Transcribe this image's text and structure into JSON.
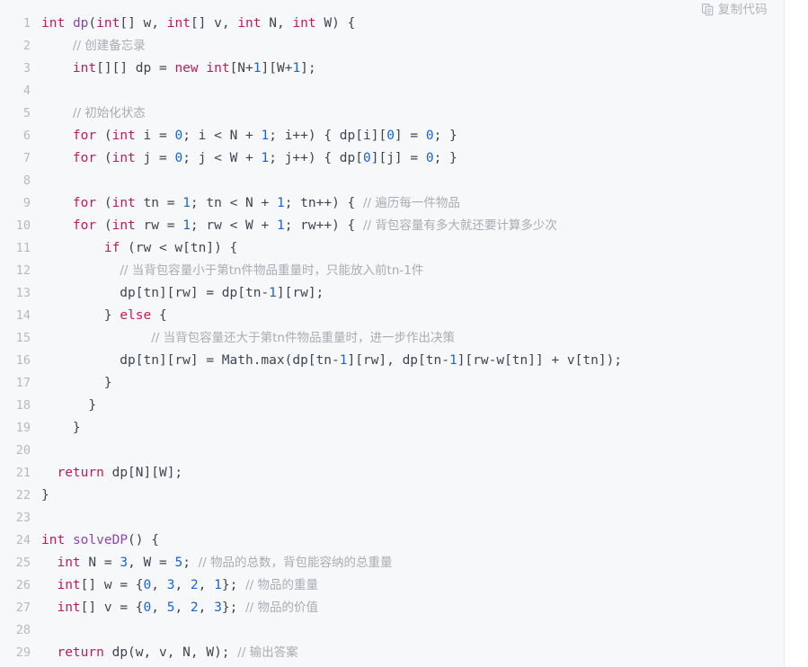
{
  "toolbar": {
    "copy_label": "复制代码",
    "copy_icon": "copy-icon"
  },
  "colors": {
    "background": "#f7f8fa",
    "page": "#ffffff",
    "border": "#e6e8eb",
    "line_number": "#b6bac0",
    "plain_text": "#3f4451",
    "keyword": "#c2185b",
    "function": "#8e44ad",
    "number": "#1565d8",
    "comment": "#a8acb3"
  },
  "editor": {
    "language": "java",
    "first_line": 1,
    "last_line": 29,
    "total_lines": 29,
    "line_numbers": [
      "1",
      "2",
      "3",
      "4",
      "5",
      "6",
      "7",
      "8",
      "9",
      "10",
      "11",
      "12",
      "13",
      "14",
      "15",
      "16",
      "17",
      "18",
      "19",
      "20",
      "21",
      "22",
      "23",
      "24",
      "25",
      "26",
      "27",
      "28",
      "29"
    ],
    "lines": [
      {
        "n": "1",
        "text": "int dp(int[] w, int[] v, int N, int W) {"
      },
      {
        "n": "2",
        "text": "    // 创建备忘录"
      },
      {
        "n": "3",
        "text": "    int[][] dp = new int[N+1][W+1];"
      },
      {
        "n": "4",
        "text": ""
      },
      {
        "n": "5",
        "text": "    // 初始化状态"
      },
      {
        "n": "6",
        "text": "    for (int i = 0; i < N + 1; i++) { dp[i][0] = 0; }"
      },
      {
        "n": "7",
        "text": "    for (int j = 0; j < W + 1; j++) { dp[0][j] = 0; }"
      },
      {
        "n": "8",
        "text": ""
      },
      {
        "n": "9",
        "text": "    for (int tn = 1; tn < N + 1; tn++) { // 遍历每一件物品"
      },
      {
        "n": "10",
        "text": "    for (int rw = 1; rw < W + 1; rw++) { // 背包容量有多大就还要计算多少次"
      },
      {
        "n": "11",
        "text": "        if (rw < w[tn]) {"
      },
      {
        "n": "12",
        "text": "          // 当背包容量小于第tn件物品重量时，只能放入前tn-1件"
      },
      {
        "n": "13",
        "text": "          dp[tn][rw] = dp[tn-1][rw];"
      },
      {
        "n": "14",
        "text": "        } else {"
      },
      {
        "n": "15",
        "text": "              // 当背包容量还大于第tn件物品重量时，进一步作出决策"
      },
      {
        "n": "16",
        "text": "          dp[tn][rw] = Math.max(dp[tn-1][rw], dp[tn-1][rw-w[tn]] + v[tn]);"
      },
      {
        "n": "17",
        "text": "        }"
      },
      {
        "n": "18",
        "text": "      }"
      },
      {
        "n": "19",
        "text": "    }"
      },
      {
        "n": "20",
        "text": ""
      },
      {
        "n": "21",
        "text": "  return dp[N][W];"
      },
      {
        "n": "22",
        "text": "}"
      },
      {
        "n": "23",
        "text": ""
      },
      {
        "n": "24",
        "text": "int solveDP() {"
      },
      {
        "n": "25",
        "text": "  int N = 3, W = 5; // 物品的总数，背包能容纳的总重量"
      },
      {
        "n": "26",
        "text": "  int[] w = {0, 3, 2, 1}; // 物品的重量"
      },
      {
        "n": "27",
        "text": "  int[] v = {0, 5, 2, 3}; // 物品的价值"
      },
      {
        "n": "28",
        "text": ""
      },
      {
        "n": "29",
        "text": "  return dp(w, v, N, W); // 输出答案"
      }
    ],
    "tokens": [
      [
        {
          "t": "int",
          "c": "kw"
        },
        {
          "t": " ",
          "c": "pl"
        },
        {
          "t": "dp",
          "c": "fn"
        },
        {
          "t": "(",
          "c": "pl"
        },
        {
          "t": "int",
          "c": "kw"
        },
        {
          "t": "[] w, ",
          "c": "pl"
        },
        {
          "t": "int",
          "c": "kw"
        },
        {
          "t": "[] v, ",
          "c": "pl"
        },
        {
          "t": "int",
          "c": "kw"
        },
        {
          "t": " N, ",
          "c": "pl"
        },
        {
          "t": "int",
          "c": "kw"
        },
        {
          "t": " W) {",
          "c": "pl"
        }
      ],
      [
        {
          "t": "    ",
          "c": "pl"
        },
        {
          "t": "// 创建备忘录",
          "c": "cmt"
        }
      ],
      [
        {
          "t": "    ",
          "c": "pl"
        },
        {
          "t": "int",
          "c": "kw"
        },
        {
          "t": "[][] dp = ",
          "c": "pl"
        },
        {
          "t": "new",
          "c": "kw"
        },
        {
          "t": " ",
          "c": "pl"
        },
        {
          "t": "int",
          "c": "kw"
        },
        {
          "t": "[N+",
          "c": "pl"
        },
        {
          "t": "1",
          "c": "num"
        },
        {
          "t": "][W+",
          "c": "pl"
        },
        {
          "t": "1",
          "c": "num"
        },
        {
          "t": "];",
          "c": "pl"
        }
      ],
      [],
      [
        {
          "t": "    ",
          "c": "pl"
        },
        {
          "t": "// 初始化状态",
          "c": "cmt"
        }
      ],
      [
        {
          "t": "    ",
          "c": "pl"
        },
        {
          "t": "for",
          "c": "kw"
        },
        {
          "t": " (",
          "c": "pl"
        },
        {
          "t": "int",
          "c": "kw"
        },
        {
          "t": " i = ",
          "c": "pl"
        },
        {
          "t": "0",
          "c": "num"
        },
        {
          "t": "; i < N + ",
          "c": "pl"
        },
        {
          "t": "1",
          "c": "num"
        },
        {
          "t": "; i++) { dp[i][",
          "c": "pl"
        },
        {
          "t": "0",
          "c": "num"
        },
        {
          "t": "] = ",
          "c": "pl"
        },
        {
          "t": "0",
          "c": "num"
        },
        {
          "t": "; }",
          "c": "pl"
        }
      ],
      [
        {
          "t": "    ",
          "c": "pl"
        },
        {
          "t": "for",
          "c": "kw"
        },
        {
          "t": " (",
          "c": "pl"
        },
        {
          "t": "int",
          "c": "kw"
        },
        {
          "t": " j = ",
          "c": "pl"
        },
        {
          "t": "0",
          "c": "num"
        },
        {
          "t": "; j < W + ",
          "c": "pl"
        },
        {
          "t": "1",
          "c": "num"
        },
        {
          "t": "; j++) { dp[",
          "c": "pl"
        },
        {
          "t": "0",
          "c": "num"
        },
        {
          "t": "][j] = ",
          "c": "pl"
        },
        {
          "t": "0",
          "c": "num"
        },
        {
          "t": "; }",
          "c": "pl"
        }
      ],
      [],
      [
        {
          "t": "    ",
          "c": "pl"
        },
        {
          "t": "for",
          "c": "kw"
        },
        {
          "t": " (",
          "c": "pl"
        },
        {
          "t": "int",
          "c": "kw"
        },
        {
          "t": " tn = ",
          "c": "pl"
        },
        {
          "t": "1",
          "c": "num"
        },
        {
          "t": "; tn < N + ",
          "c": "pl"
        },
        {
          "t": "1",
          "c": "num"
        },
        {
          "t": "; tn++) { ",
          "c": "pl"
        },
        {
          "t": "// 遍历每一件物品",
          "c": "cmt"
        }
      ],
      [
        {
          "t": "    ",
          "c": "pl"
        },
        {
          "t": "for",
          "c": "kw"
        },
        {
          "t": " (",
          "c": "pl"
        },
        {
          "t": "int",
          "c": "kw"
        },
        {
          "t": " rw = ",
          "c": "pl"
        },
        {
          "t": "1",
          "c": "num"
        },
        {
          "t": "; rw < W + ",
          "c": "pl"
        },
        {
          "t": "1",
          "c": "num"
        },
        {
          "t": "; rw++) { ",
          "c": "pl"
        },
        {
          "t": "// 背包容量有多大就还要计算多少次",
          "c": "cmt"
        }
      ],
      [
        {
          "t": "        ",
          "c": "pl"
        },
        {
          "t": "if",
          "c": "kw"
        },
        {
          "t": " (rw < w[tn]) {",
          "c": "pl"
        }
      ],
      [
        {
          "t": "          ",
          "c": "pl"
        },
        {
          "t": "// 当背包容量小于第tn件物品重量时，只能放入前tn-1件",
          "c": "cmt"
        }
      ],
      [
        {
          "t": "          dp[tn][rw] = dp[tn-",
          "c": "pl"
        },
        {
          "t": "1",
          "c": "num"
        },
        {
          "t": "][rw];",
          "c": "pl"
        }
      ],
      [
        {
          "t": "        } ",
          "c": "pl"
        },
        {
          "t": "else",
          "c": "kw"
        },
        {
          "t": " {",
          "c": "pl"
        }
      ],
      [
        {
          "t": "              ",
          "c": "pl"
        },
        {
          "t": "// 当背包容量还大于第tn件物品重量时，进一步作出决策",
          "c": "cmt"
        }
      ],
      [
        {
          "t": "          dp[tn][rw] = Math.max(dp[tn-",
          "c": "pl"
        },
        {
          "t": "1",
          "c": "num"
        },
        {
          "t": "][rw], dp[tn-",
          "c": "pl"
        },
        {
          "t": "1",
          "c": "num"
        },
        {
          "t": "][rw-w[tn]] + v[tn]);",
          "c": "pl"
        }
      ],
      [
        {
          "t": "        }",
          "c": "pl"
        }
      ],
      [
        {
          "t": "      }",
          "c": "pl"
        }
      ],
      [
        {
          "t": "    }",
          "c": "pl"
        }
      ],
      [],
      [
        {
          "t": "  ",
          "c": "pl"
        },
        {
          "t": "return",
          "c": "kw"
        },
        {
          "t": " dp[N][W];",
          "c": "pl"
        }
      ],
      [
        {
          "t": "}",
          "c": "pl"
        }
      ],
      [],
      [
        {
          "t": "int",
          "c": "kw"
        },
        {
          "t": " ",
          "c": "pl"
        },
        {
          "t": "solveDP",
          "c": "fn"
        },
        {
          "t": "() {",
          "c": "pl"
        }
      ],
      [
        {
          "t": "  ",
          "c": "pl"
        },
        {
          "t": "int",
          "c": "kw"
        },
        {
          "t": " N = ",
          "c": "pl"
        },
        {
          "t": "3",
          "c": "num"
        },
        {
          "t": ", W = ",
          "c": "pl"
        },
        {
          "t": "5",
          "c": "num"
        },
        {
          "t": "; ",
          "c": "pl"
        },
        {
          "t": "// 物品的总数，背包能容纳的总重量",
          "c": "cmt"
        }
      ],
      [
        {
          "t": "  ",
          "c": "pl"
        },
        {
          "t": "int",
          "c": "kw"
        },
        {
          "t": "[] w = {",
          "c": "pl"
        },
        {
          "t": "0",
          "c": "num"
        },
        {
          "t": ", ",
          "c": "pl"
        },
        {
          "t": "3",
          "c": "num"
        },
        {
          "t": ", ",
          "c": "pl"
        },
        {
          "t": "2",
          "c": "num"
        },
        {
          "t": ", ",
          "c": "pl"
        },
        {
          "t": "1",
          "c": "num"
        },
        {
          "t": "}; ",
          "c": "pl"
        },
        {
          "t": "// 物品的重量",
          "c": "cmt"
        }
      ],
      [
        {
          "t": "  ",
          "c": "pl"
        },
        {
          "t": "int",
          "c": "kw"
        },
        {
          "t": "[] v = {",
          "c": "pl"
        },
        {
          "t": "0",
          "c": "num"
        },
        {
          "t": ", ",
          "c": "pl"
        },
        {
          "t": "5",
          "c": "num"
        },
        {
          "t": ", ",
          "c": "pl"
        },
        {
          "t": "2",
          "c": "num"
        },
        {
          "t": ", ",
          "c": "pl"
        },
        {
          "t": "3",
          "c": "num"
        },
        {
          "t": "}; ",
          "c": "pl"
        },
        {
          "t": "// 物品的价值",
          "c": "cmt"
        }
      ],
      [],
      [
        {
          "t": "  ",
          "c": "pl"
        },
        {
          "t": "return",
          "c": "kw"
        },
        {
          "t": " dp(w, v, N, W); ",
          "c": "pl"
        },
        {
          "t": "// 输出答案",
          "c": "cmt"
        }
      ]
    ]
  }
}
